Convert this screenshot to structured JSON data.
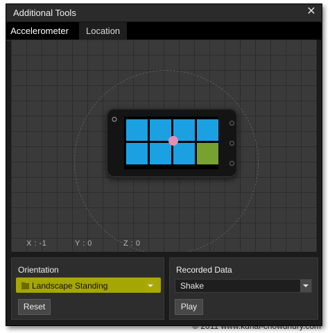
{
  "window": {
    "title": "Additional Tools",
    "close_glyph": "✕"
  },
  "tabs": [
    {
      "label": "Accelerometer",
      "active": true
    },
    {
      "label": "Location",
      "active": false
    }
  ],
  "readout": {
    "x": "X : -1",
    "y": "Y : 0",
    "z": "Z : 0"
  },
  "orientation": {
    "title": "Orientation",
    "selected": "Landscape Standing",
    "reset_label": "Reset"
  },
  "recorded": {
    "title": "Recorded Data",
    "selected": "Shake",
    "play_label": "Play"
  },
  "watermark": "© 2011 www.kunal-chowdhury.com",
  "colors": {
    "tile": "#1ba1e2",
    "tile_accent": "#78a22f",
    "ball": "#e58fb5",
    "highlight": "#bdbd00"
  },
  "icons": [
    "close-icon",
    "folder-icon",
    "dropdown-arrow-icon",
    "phone-search-icon"
  ]
}
